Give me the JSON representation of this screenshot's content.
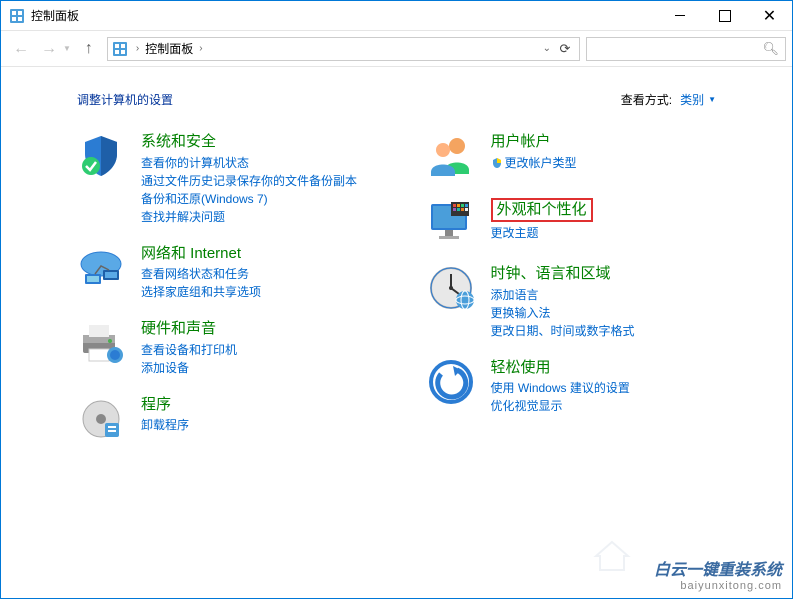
{
  "window": {
    "title": "控制面板"
  },
  "breadcrumb": {
    "root": "控制面板"
  },
  "header": {
    "page_title": "调整计算机的设置",
    "view_by_label": "查看方式:",
    "view_by_value": "类别"
  },
  "categories": {
    "left": [
      {
        "title": "系统和安全",
        "links": [
          "查看你的计算机状态",
          "通过文件历史记录保存你的文件备份副本",
          "备份和还原(Windows 7)",
          "查找并解决问题"
        ]
      },
      {
        "title": "网络和 Internet",
        "links": [
          "查看网络状态和任务",
          "选择家庭组和共享选项"
        ]
      },
      {
        "title": "硬件和声音",
        "links": [
          "查看设备和打印机",
          "添加设备"
        ]
      },
      {
        "title": "程序",
        "links": [
          "卸载程序"
        ]
      }
    ],
    "right": [
      {
        "title": "用户帐户",
        "links": [
          "更改帐户类型"
        ],
        "shield": true
      },
      {
        "title": "外观和个性化",
        "links": [
          "更改主题"
        ],
        "highlighted": true
      },
      {
        "title": "时钟、语言和区域",
        "links": [
          "添加语言",
          "更换输入法",
          "更改日期、时间或数字格式"
        ]
      },
      {
        "title": "轻松使用",
        "links": [
          "使用 Windows 建议的设置",
          "优化视觉显示"
        ]
      }
    ]
  },
  "watermark": {
    "title": "白云一键重装系统",
    "url": "baiyunxitong.com"
  }
}
